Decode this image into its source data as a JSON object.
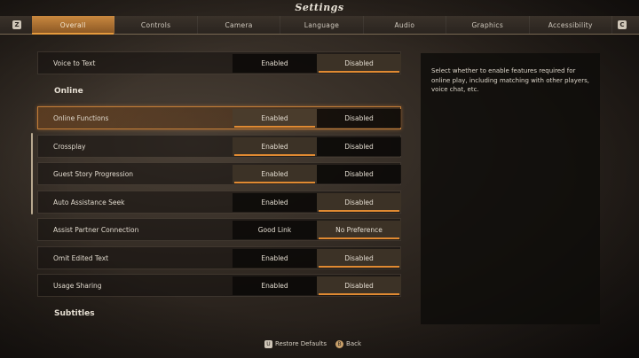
{
  "title": "Settings",
  "tabs": [
    "Overall",
    "Controls",
    "Camera",
    "Language",
    "Audio",
    "Graphics",
    "Accessibility"
  ],
  "active_tab": "Overall",
  "bumpers": {
    "left": "Z",
    "right": "C"
  },
  "rows": [
    {
      "label": "Voice to Text",
      "opt1": "Enabled",
      "opt2": "Disabled",
      "selected": 2
    },
    {
      "label": "Online Functions",
      "opt1": "Enabled",
      "opt2": "Disabled",
      "selected": 1
    },
    {
      "label": "Crossplay",
      "opt1": "Enabled",
      "opt2": "Disabled",
      "selected": 1
    },
    {
      "label": "Guest Story Progression",
      "opt1": "Enabled",
      "opt2": "Disabled",
      "selected": 1
    },
    {
      "label": "Auto Assistance Seek",
      "opt1": "Enabled",
      "opt2": "Disabled",
      "selected": 2
    },
    {
      "label": "Assist Partner Connection",
      "opt1": "Good Link",
      "opt2": "No Preference",
      "selected": 2
    },
    {
      "label": "Omit Edited Text",
      "opt1": "Enabled",
      "opt2": "Disabled",
      "selected": 2
    },
    {
      "label": "Usage Sharing",
      "opt1": "Enabled",
      "opt2": "Disabled",
      "selected": 2
    }
  ],
  "sections": {
    "online": "Online",
    "subtitles": "Subtitles"
  },
  "description": "Select whether to enable features required for online play, including matching with other players, voice chat, etc.",
  "footer": {
    "restore_key": "U",
    "restore": "Restore Defaults",
    "back_key": "B",
    "back": "Back"
  },
  "colors": {
    "accent": "#e08a32",
    "active_tab": "#c9883f"
  }
}
